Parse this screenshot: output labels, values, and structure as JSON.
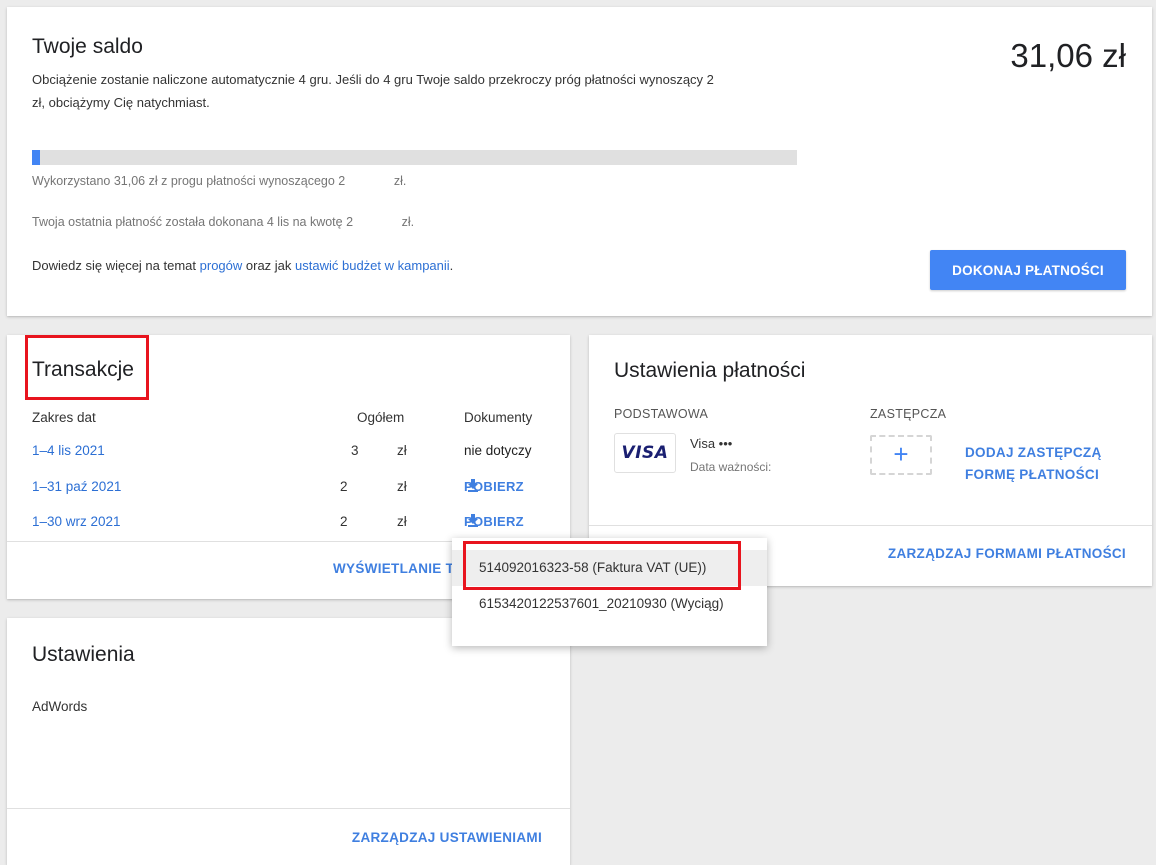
{
  "balance": {
    "title": "Twoje saldo",
    "amount": "31,06 zł",
    "description": "Obciążenie zostanie naliczone automatycznie 4 gru. Jeśli do 4 gru Twoje saldo przekroczy próg płatności wynoszący 2              zł, obciążymy Cię natychmiast.",
    "progress_fraction": 0.01,
    "usage_text": "Wykorzystano 31,06 zł z progu płatności wynoszącego 2              zł.",
    "last_payment_text": "Twoja ostatnia płatność została dokonana 4 lis na kwotę 2              zł.",
    "learn_more_prefix": "Dowiedz się więcej na temat ",
    "learn_more_link1": "progów",
    "learn_more_middle": " oraz jak ",
    "learn_more_link2": "ustawić budżet w kampanii",
    "learn_more_suffix": ".",
    "pay_button": "DOKONAJ PŁATNOŚCI"
  },
  "transactions": {
    "title": "Transakcje",
    "headers": {
      "date_range": "Zakres dat",
      "total": "Ogółem",
      "documents": "Dokumenty"
    },
    "rows": [
      {
        "date": "1–4 lis 2021",
        "amount": "3",
        "currency": "zł",
        "document": "nie dotyczy"
      },
      {
        "date": "1–31 paź 2021",
        "amount": "2",
        "currency": "zł",
        "document": "POBIERZ"
      },
      {
        "date": "1–30 wrz 2021",
        "amount": "2",
        "currency": "zł",
        "document": "POBIERZ"
      }
    ],
    "view_link": "WYŚWIETLANIE T"
  },
  "document_menu": {
    "items": [
      "514092016323-58 (Faktura VAT (UE))",
      "6153420122537601_20210930 (Wyciąg)"
    ]
  },
  "payment_settings": {
    "title": "Ustawienia płatności",
    "primary_label": "PODSTAWOWA",
    "backup_label": "ZASTĘPCZA",
    "card_brand": "VISA",
    "card_name": "Visa •••",
    "card_expiry_label": "Data ważności:",
    "add_backup_link_line1": "DODAJ ZASTĘPCZĄ",
    "add_backup_link_line2": "FORMĘ PŁATNOŚCI",
    "add_symbol": "+",
    "manage_link": "ZARZĄDZAJ FORMAMI PŁATNOŚCI"
  },
  "settings": {
    "title": "Ustawienia",
    "product": "AdWords",
    "manage_link": "ZARZĄDZAJ USTAWIENIAMI"
  },
  "colors": {
    "accent": "#4285f4",
    "link": "#2c6fd4",
    "highlight": "#e8141e"
  }
}
